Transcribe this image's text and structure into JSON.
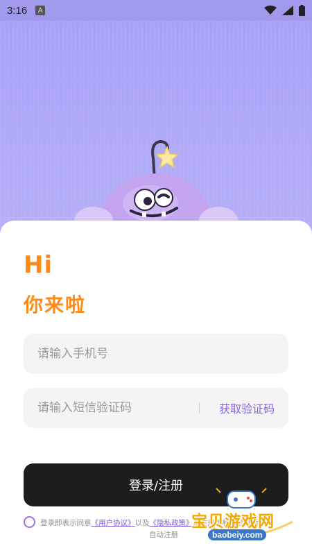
{
  "status_bar": {
    "time": "3:16",
    "notification_icon": "a-letter-icon",
    "icons": [
      "wifi-icon",
      "signal-icon",
      "battery-icon"
    ]
  },
  "greeting": {
    "hi": "Hi",
    "subtitle": "你来啦"
  },
  "form": {
    "phone_placeholder": "请输入手机号",
    "code_placeholder": "请输入短信验证码",
    "get_code_label": "获取验证码",
    "submit_label": "登录/注册"
  },
  "agreement": {
    "prefix": "登录即表示同意",
    "user_agreement": "《用户协议》",
    "connector": "以及",
    "privacy_policy": "《隐私政策》",
    "suffix": "未注册手机号验证后",
    "line2": "自动注册"
  },
  "watermark": {
    "title": "宝贝游戏网",
    "url": "baobeiy.com"
  },
  "colors": {
    "accent_orange": "#ff8a16",
    "accent_purple": "#8a64e6",
    "button_dark": "#1d1d1f",
    "background_top": "#a6a0f7"
  }
}
